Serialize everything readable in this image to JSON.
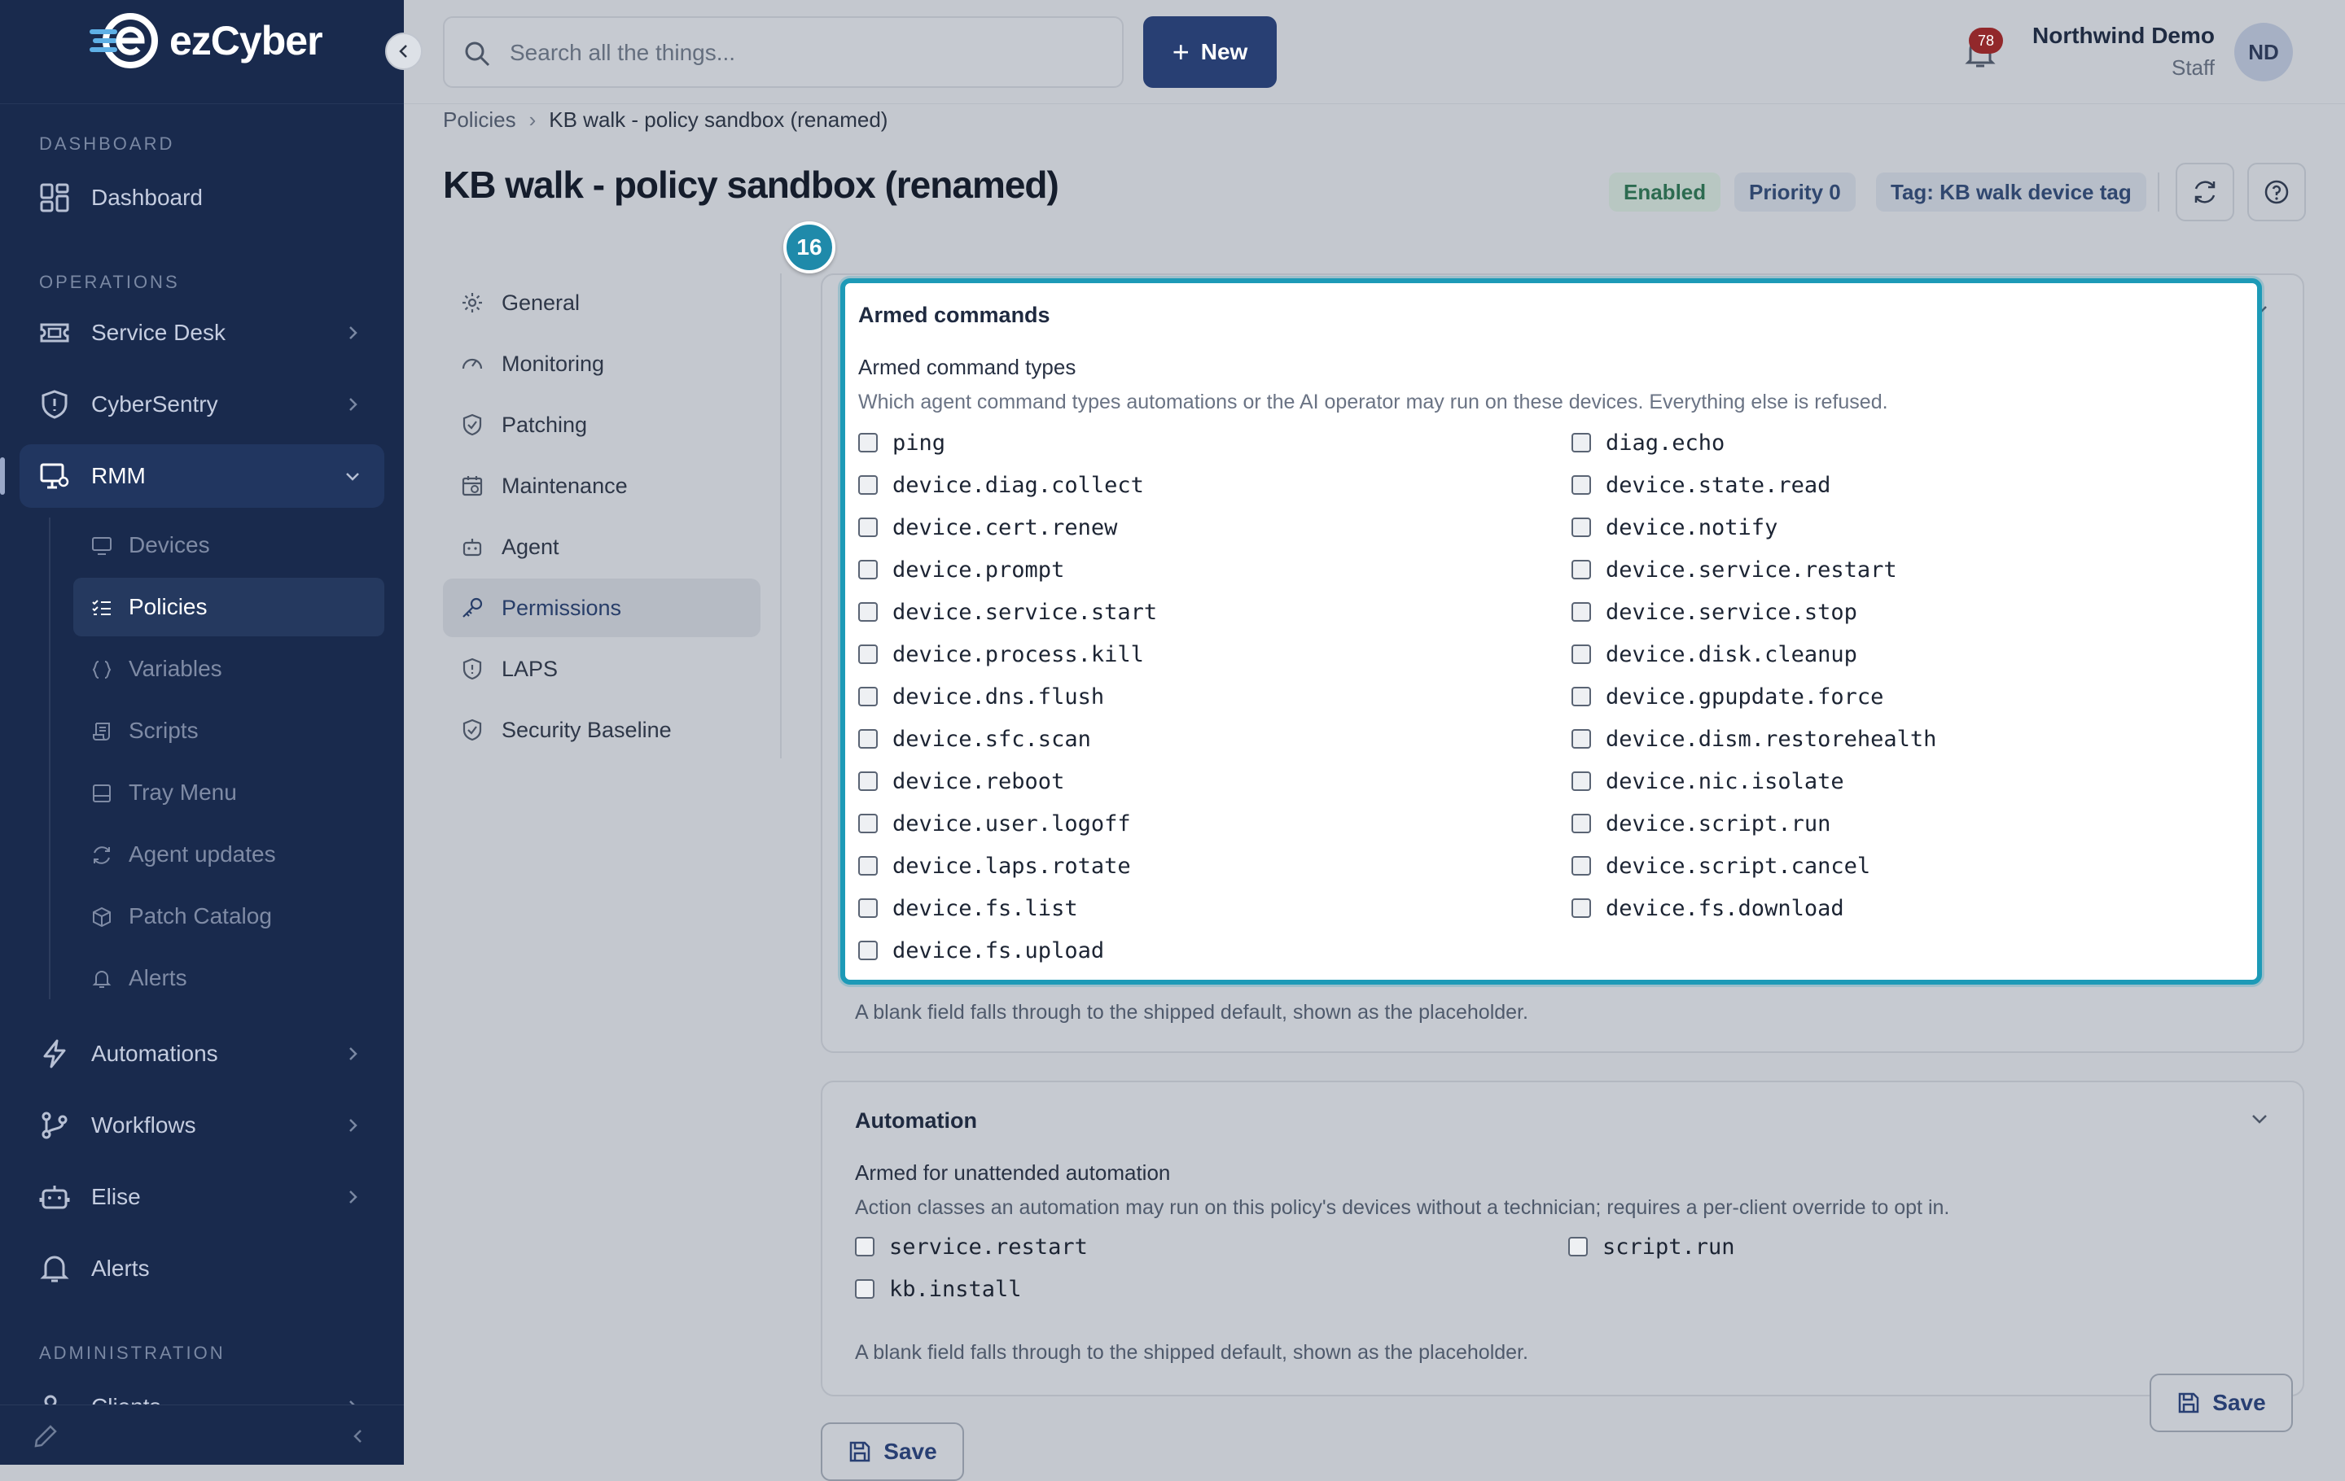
{
  "app": {
    "logo_text": "ezCyber"
  },
  "topbar": {
    "search_placeholder": "Search all the things...",
    "new_label": "New",
    "notification_count": "78",
    "user_name": "Northwind Demo",
    "user_role": "Staff",
    "avatar_initials": "ND"
  },
  "sidebar": {
    "sections": {
      "dashboard": "DASHBOARD",
      "operations": "OPERATIONS",
      "administration": "ADMINISTRATION"
    },
    "items": {
      "dashboard": "Dashboard",
      "service_desk": "Service Desk",
      "cybersentry": "CyberSentry",
      "rmm": "RMM",
      "automations": "Automations",
      "workflows": "Workflows",
      "elise": "Elise",
      "alerts": "Alerts",
      "clients": "Clients"
    },
    "rmm_children": {
      "devices": "Devices",
      "policies": "Policies",
      "variables": "Variables",
      "scripts": "Scripts",
      "tray_menu": "Tray Menu",
      "agent_updates": "Agent updates",
      "patch_catalog": "Patch Catalog",
      "alerts": "Alerts"
    }
  },
  "breadcrumb": {
    "parent": "Policies",
    "current": "KB walk - policy sandbox (renamed)"
  },
  "page": {
    "title": "KB walk - policy sandbox (renamed)",
    "badges": {
      "enabled": "Enabled",
      "priority": "Priority 0",
      "tag": "Tag: KB walk device tag"
    }
  },
  "tabs": {
    "general": "General",
    "monitoring": "Monitoring",
    "patching": "Patching",
    "maintenance": "Maintenance",
    "agent": "Agent",
    "permissions": "Permissions",
    "laps": "LAPS",
    "security_baseline": "Security Baseline"
  },
  "step_badge": "16",
  "armed_commands": {
    "title": "Armed commands",
    "field_title": "Armed command types",
    "help": "Which agent command types automations or the AI operator may run on these devices. Everything else is refused.",
    "footer": "A blank field falls through to the shipped default, shown as the placeholder.",
    "left": [
      "ping",
      "device.diag.collect",
      "device.cert.renew",
      "device.prompt",
      "device.service.start",
      "device.process.kill",
      "device.dns.flush",
      "device.sfc.scan",
      "device.reboot",
      "device.user.logoff",
      "device.laps.rotate",
      "device.fs.list",
      "device.fs.upload"
    ],
    "right": [
      "diag.echo",
      "device.state.read",
      "device.notify",
      "device.service.restart",
      "device.service.stop",
      "device.disk.cleanup",
      "device.gpupdate.force",
      "device.dism.restorehealth",
      "device.nic.isolate",
      "device.script.run",
      "device.script.cancel",
      "device.fs.download"
    ]
  },
  "automation": {
    "title": "Automation",
    "field_title": "Armed for unattended automation",
    "help": "Action classes an automation may run on this policy's devices without a technician; requires a per-client override to opt in.",
    "footer": "A blank field falls through to the shipped default, shown as the placeholder.",
    "options": {
      "service_restart": "service.restart",
      "script_run": "script.run",
      "kb_install": "kb.install"
    }
  },
  "actions": {
    "save_label": "Save",
    "save_floating_label": "Save"
  }
}
